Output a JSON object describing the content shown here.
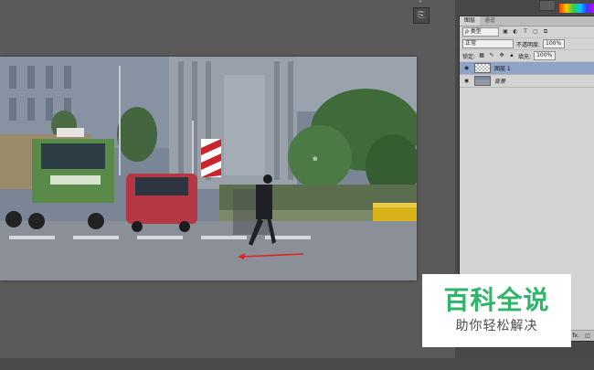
{
  "layers_panel": {
    "tabs": [
      "图层",
      "通道"
    ],
    "filter_kind": "ρ 类型",
    "blend_mode": "正常",
    "opacity_label": "不透明度:",
    "opacity_value": "100%",
    "lock_label": "锁定:",
    "fill_label": "填充:",
    "fill_value": "100%",
    "layers": [
      {
        "name": "图层 1",
        "visible": true,
        "selected": true
      },
      {
        "name": "背景",
        "visible": true,
        "selected": false
      }
    ],
    "footer_fx": "fx."
  },
  "watermark": {
    "title": "百科全说",
    "subtitle": "助你轻松解决"
  },
  "colors": {
    "workspace": "#5a5a5a",
    "panel": "#d3d3d3",
    "selected_layer": "#8da4c8",
    "watermark_green": "#2fb56a",
    "arrow_red": "#e0231e"
  }
}
